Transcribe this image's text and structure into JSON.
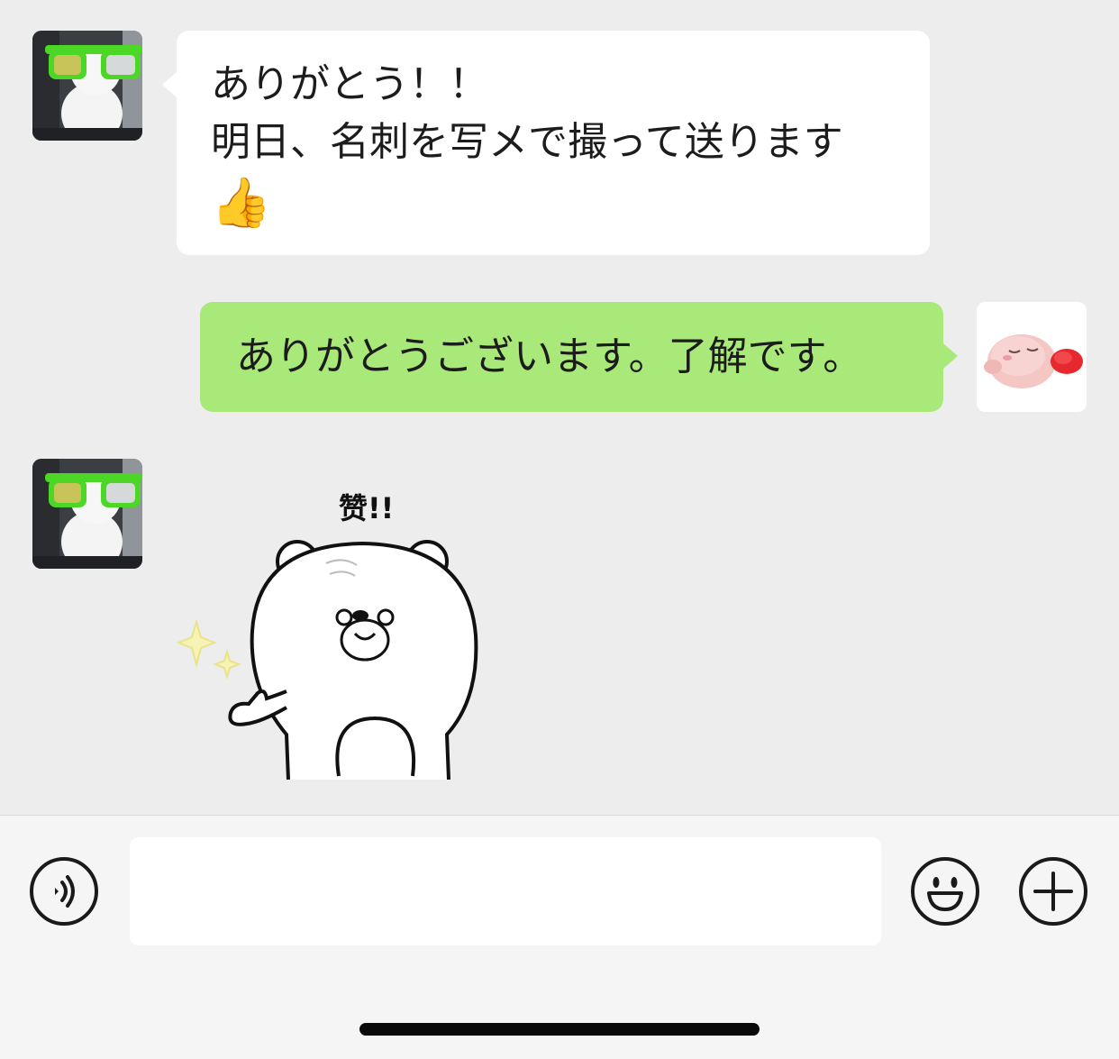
{
  "messages": [
    {
      "direction": "incoming",
      "avatar_icon": "snowman-sunglasses-avatar-icon",
      "lines": [
        "ありがとう！！",
        "明日、名刺を写メで撮って送ります"
      ],
      "emoji": "👍"
    },
    {
      "direction": "outgoing",
      "avatar_icon": "pink-plush-avatar-icon",
      "text": "ありがとうございます。了解です。"
    },
    {
      "direction": "incoming",
      "avatar_icon": "snowman-sunglasses-avatar-icon",
      "sticker": {
        "caption": "赞!!",
        "icon": "bear-thumbs-up-sticker-icon"
      }
    }
  ],
  "input_bar": {
    "voice_icon": "voice-icon",
    "placeholder": "",
    "emoji_icon": "smiley-icon",
    "add_icon": "plus-icon"
  },
  "colors": {
    "background": "#ededed",
    "incoming_bubble": "#ffffff",
    "outgoing_bubble": "#a9e97a",
    "sunglasses": "#4cd626"
  }
}
